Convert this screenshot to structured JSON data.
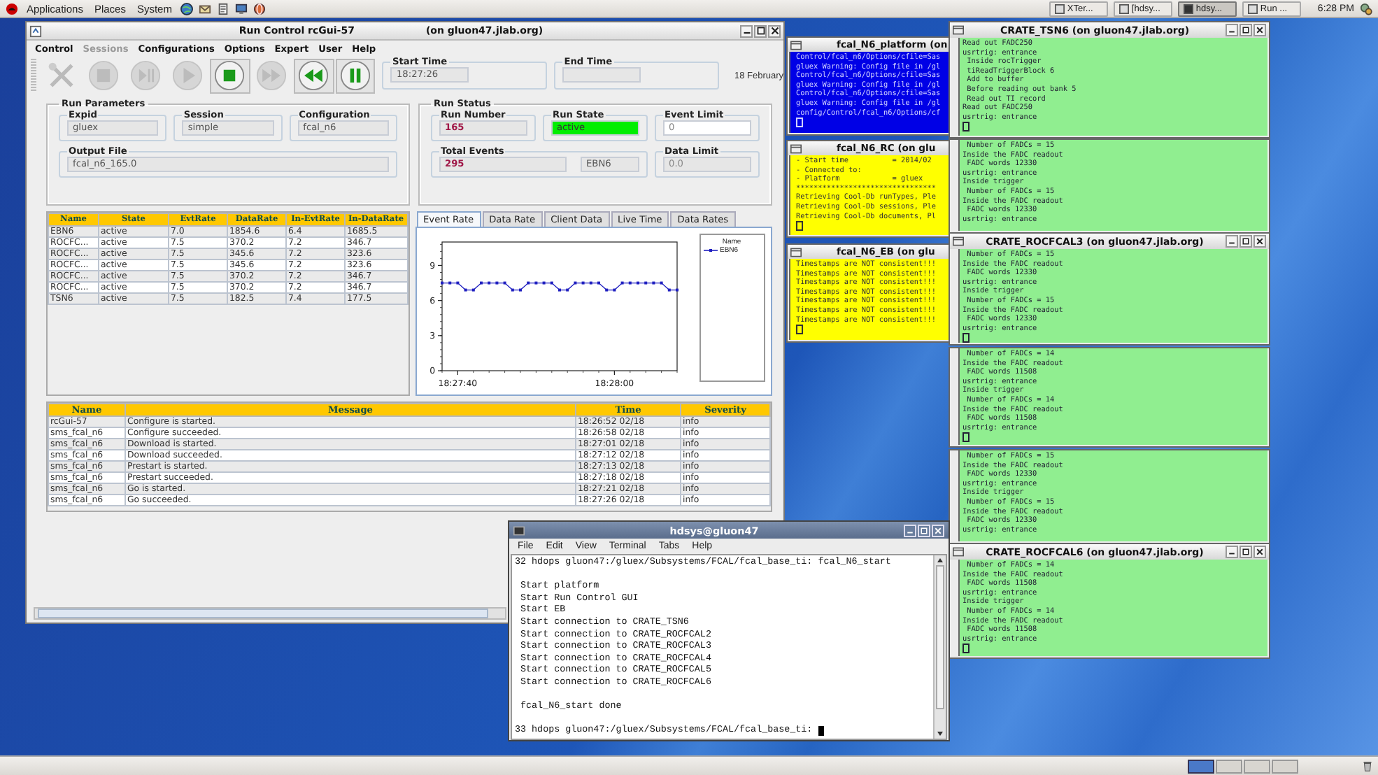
{
  "top_panel": {
    "menus": [
      "Applications",
      "Places",
      "System"
    ],
    "taskbar": [
      {
        "label": "XTer...",
        "selected": false
      },
      {
        "label": "[hdsy...",
        "selected": false
      },
      {
        "label": "hdsy...",
        "selected": true
      },
      {
        "label": "Run ...",
        "selected": false
      }
    ],
    "clock": "6:28 PM"
  },
  "run_control": {
    "title": "Run Control rcGui-57",
    "host": "(on gluon47.jlab.org)",
    "menu": [
      {
        "label": "Control",
        "disabled": false
      },
      {
        "label": "Sessions",
        "disabled": true
      },
      {
        "label": "Configurations",
        "disabled": false
      },
      {
        "label": "Options",
        "disabled": false
      },
      {
        "label": "Expert",
        "disabled": false
      },
      {
        "label": "User",
        "disabled": false
      },
      {
        "label": "Help",
        "disabled": false
      }
    ],
    "toolbar": [
      {
        "kind": "tools",
        "disabled": true
      },
      {
        "kind": "disk",
        "disabled": true
      },
      {
        "kind": "step",
        "disabled": true
      },
      {
        "kind": "play",
        "disabled": true
      },
      {
        "kind": "stop",
        "disabled": false
      },
      {
        "kind": "forward",
        "disabled": true
      },
      {
        "kind": "rewind",
        "disabled": false
      },
      {
        "kind": "pause",
        "disabled": false
      }
    ],
    "start_time": {
      "label": "Start Time",
      "value": "18:27:26"
    },
    "end_time": {
      "label": "End Time"
    },
    "date": "18 February",
    "run_parameters": {
      "title": "Run Parameters",
      "fields": [
        {
          "label": "Expid",
          "value": "gluex"
        },
        {
          "label": "Session",
          "value": "simple"
        },
        {
          "label": "Configuration",
          "value": "fcal_n6"
        },
        {
          "label": "Output File",
          "value": "fcal_n6_165.0"
        }
      ]
    },
    "run_status": {
      "title": "Run Status",
      "run_number": {
        "label": "Run Number",
        "value": "165"
      },
      "run_state": {
        "label": "Run State",
        "value": "active"
      },
      "event_limit": {
        "label": "Event Limit",
        "value": "0",
        "disabled": false
      },
      "total_events": {
        "label": "Total Events",
        "value": "295",
        "component": "EBN6"
      },
      "data_limit": {
        "label": "Data Limit",
        "value": "0.0",
        "disabled": true
      }
    },
    "components": {
      "columns": [
        "Name",
        "State",
        "EvtRate",
        "DataRate",
        "In-EvtRate",
        "In-DataRate"
      ],
      "rows": [
        [
          "EBN6",
          "active",
          "7.0",
          "1854.6",
          "6.4",
          "1685.5"
        ],
        [
          "ROCFC...",
          "active",
          "7.5",
          "370.2",
          "7.2",
          "346.7"
        ],
        [
          "ROCFC...",
          "active",
          "7.5",
          "345.6",
          "7.2",
          "323.6"
        ],
        [
          "ROCFC...",
          "active",
          "7.5",
          "345.6",
          "7.2",
          "323.6"
        ],
        [
          "ROCFC...",
          "active",
          "7.5",
          "370.2",
          "7.2",
          "346.7"
        ],
        [
          "ROCFC...",
          "active",
          "7.5",
          "370.2",
          "7.2",
          "346.7"
        ],
        [
          "TSN6",
          "active",
          "7.5",
          "182.5",
          "7.4",
          "177.5"
        ]
      ]
    },
    "tabs": [
      {
        "label": "Event Rate",
        "selected": true
      },
      {
        "label": "Data Rate",
        "selected": false
      },
      {
        "label": "Client Data",
        "selected": false
      },
      {
        "label": "Live Time",
        "selected": false
      },
      {
        "label": "Data Rates",
        "selected": false
      }
    ],
    "legend_title": "Name",
    "chart_data": {
      "type": "line",
      "categories": [
        null,
        null,
        "18:27:40",
        null,
        null,
        null,
        null,
        null,
        null,
        null,
        null,
        null,
        null,
        null,
        null,
        null,
        null,
        null,
        null,
        null,
        null,
        null,
        "18:28:00",
        null,
        null,
        null,
        null,
        null,
        null,
        null,
        null
      ],
      "ylim": [
        0,
        11
      ],
      "yticks": [
        0,
        3,
        6,
        9
      ],
      "series": [
        {
          "name": "EBN6",
          "color": "#2020c0",
          "marker": "square",
          "values": [
            7.5,
            7.5,
            7.5,
            6.9,
            6.9,
            7.5,
            7.5,
            7.5,
            7.5,
            6.9,
            6.9,
            7.5,
            7.5,
            7.5,
            7.5,
            6.9,
            6.9,
            7.5,
            7.5,
            7.5,
            7.5,
            6.9,
            6.9,
            7.5,
            7.5,
            7.5,
            7.5,
            7.5,
            7.5,
            6.9,
            6.9
          ]
        }
      ]
    },
    "messages": {
      "columns": [
        "Name",
        "Message",
        "Time",
        "Severity"
      ],
      "rows": [
        [
          "rcGui-57",
          "Configure is started.",
          "18:26:52 02/18",
          "info"
        ],
        [
          "sms_fcal_n6",
          "Configure succeeded.",
          "18:26:58 02/18",
          "info"
        ],
        [
          "sms_fcal_n6",
          "Download is started.",
          "18:27:01 02/18",
          "info"
        ],
        [
          "sms_fcal_n6",
          "Download succeeded.",
          "18:27:12 02/18",
          "info"
        ],
        [
          "sms_fcal_n6",
          "Prestart is started.",
          "18:27:13 02/18",
          "info"
        ],
        [
          "sms_fcal_n6",
          "Prestart succeeded.",
          "18:27:18 02/18",
          "info"
        ],
        [
          "sms_fcal_n6",
          "Go is started.",
          "18:27:21 02/18",
          "info"
        ],
        [
          "sms_fcal_n6",
          "Go succeeded.",
          "18:27:26 02/18",
          "info"
        ]
      ]
    }
  },
  "log_windows": [
    {
      "title": "fcal_N6_platform (on",
      "kind": "blue",
      "lines": [
        "Control/fcal_n6/Options/cfile=Sas",
        "gluex Warning: Config file in /gl",
        "Control/fcal_n6/Options/cfile=Sas",
        "gluex Warning: Config file in /gl",
        "Control/fcal_n6/Options/cfile=Sas",
        "gluex Warning: Config file in /gl",
        "config/Control/fcal_n6/Options/cf"
      ]
    },
    {
      "title": "fcal_N6_RC (on glu",
      "kind": "yellow",
      "lines": [
        "- Start time          = 2014/02",
        "- Connected to:",
        "- Platform            = gluex",
        "********************************",
        "Retrieving Cool-Db runTypes, Ple",
        "Retrieving Cool-Db sessions, Ple",
        "Retrieving Cool-Db documents, Pl"
      ]
    },
    {
      "title": "fcal_N6_EB (on glu",
      "kind": "yellow",
      "lines": [
        "Timestamps are NOT consistent!!!",
        "Timestamps are NOT consistent!!!",
        "Timestamps are NOT consistent!!!",
        "Timestamps are NOT consistent!!!",
        "Timestamps are NOT consistent!!!",
        "Timestamps are NOT consistent!!!",
        "Timestamps are NOT consistent!!!"
      ]
    }
  ],
  "crate_windows": [
    {
      "title": "CRATE_TSN6 (on gluon47.jlab.org)",
      "cursor": true,
      "lines": [
        "Read out FADC250",
        "usrtrig: entrance",
        " Inside rocTrigger",
        " tiReadTriggerBlock 6",
        " Add to buffer",
        " Before reading out bank 5",
        " Read out TI record",
        "Read out FADC250",
        "usrtrig: entrance"
      ]
    },
    {
      "cursor": false,
      "lines": [
        " Number of FADCs = 15",
        "Inside the FADC readout",
        " FADC words 12330",
        "usrtrig: entrance",
        "Inside trigger",
        " Number of FADCs = 15",
        "Inside the FADC readout",
        " FADC words 12330",
        "usrtrig: entrance"
      ]
    },
    {
      "title": "CRATE_ROCFCAL3 (on gluon47.jlab.org)",
      "cursor": true,
      "lines": [
        " Number of FADCs = 15",
        "Inside the FADC readout",
        " FADC words 12330",
        "usrtrig: entrance",
        "Inside trigger",
        " Number of FADCs = 15",
        "Inside the FADC readout",
        " FADC words 12330",
        "usrtrig: entrance"
      ]
    },
    {
      "cursor": true,
      "lines": [
        " Number of FADCs = 14",
        "Inside the FADC readout",
        " FADC words 11508",
        "usrtrig: entrance",
        "Inside trigger",
        " Number of FADCs = 14",
        "Inside the FADC readout",
        " FADC words 11508",
        "usrtrig: entrance"
      ]
    },
    {
      "cursor": false,
      "lines": [
        " Number of FADCs = 15",
        "Inside the FADC readout",
        " FADC words 12330",
        "usrtrig: entrance",
        "Inside trigger",
        " Number of FADCs = 15",
        "Inside the FADC readout",
        " FADC words 12330",
        "usrtrig: entrance"
      ]
    },
    {
      "title": "CRATE_ROCFCAL6 (on gluon47.jlab.org)",
      "cursor": true,
      "lines": [
        " Number of FADCs = 14",
        "Inside the FADC readout",
        " FADC words 11508",
        "usrtrig: entrance",
        "Inside trigger",
        " Number of FADCs = 14",
        "Inside the FADC readout",
        " FADC words 11508",
        "usrtrig: entrance"
      ]
    }
  ],
  "terminal": {
    "title": "hdsys@gluon47",
    "menu": [
      "File",
      "Edit",
      "View",
      "Terminal",
      "Tabs",
      "Help"
    ],
    "blocks": [
      [
        "32 hdops gluon47:/gluex/Subsystems/FCAL/fcal_base_ti: fcal_N6_start"
      ],
      [
        " Start platform",
        " Start Run Control GUI",
        " Start EB",
        " Start connection to CRATE_TSN6",
        " Start connection to CRATE_ROCFCAL2",
        " Start connection to CRATE_ROCFCAL3",
        " Start connection to CRATE_ROCFCAL4",
        " Start connection to CRATE_ROCFCAL5",
        " Start connection to CRATE_ROCFCAL6"
      ],
      [
        " fcal_N6_start done"
      ]
    ],
    "prompt": "33 hdops gluon47:/gluex/Subsystems/FCAL/fcal_base_ti:"
  },
  "bottom_panel": {
    "workspaces": [
      {
        "selected": true
      },
      {
        "selected": false
      },
      {
        "selected": false
      },
      {
        "selected": false
      }
    ]
  }
}
